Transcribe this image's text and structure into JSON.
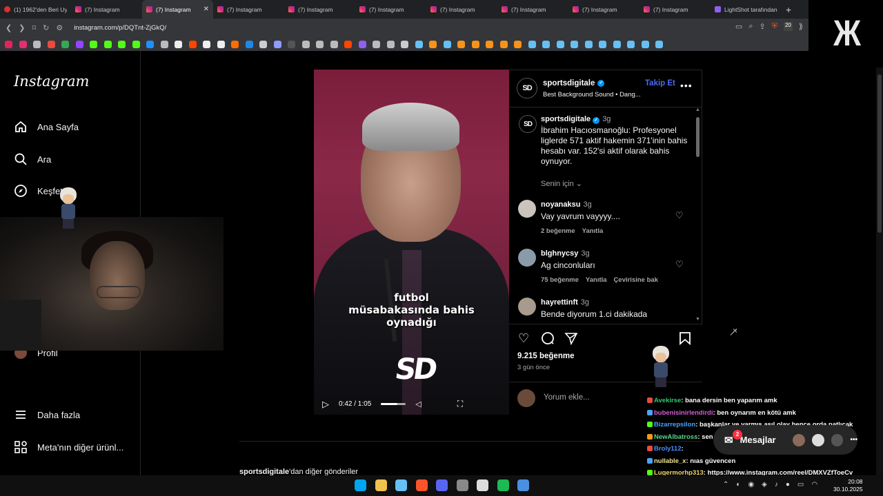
{
  "browser": {
    "tabs": [
      {
        "label": "(1) 1962'den Beri Uy",
        "icon": "red-circle",
        "active": false
      },
      {
        "label": "(7) Instagram",
        "icon": "instagram",
        "active": false
      },
      {
        "label": "(7) Instagram",
        "icon": "instagram",
        "active": true
      },
      {
        "label": "(7) Instagram",
        "icon": "instagram",
        "active": false
      },
      {
        "label": "(7) Instagram",
        "icon": "instagram",
        "active": false
      },
      {
        "label": "(7) Instagram",
        "icon": "instagram",
        "active": false
      },
      {
        "label": "(7) Instagram",
        "icon": "instagram",
        "active": false
      },
      {
        "label": "(7) Instagram",
        "icon": "instagram",
        "active": false
      },
      {
        "label": "(7) Instagram",
        "icon": "instagram",
        "active": false
      },
      {
        "label": "(7) Instagram",
        "icon": "instagram",
        "active": false
      },
      {
        "label": "LightShot tarafından",
        "icon": "lightshot",
        "active": false
      }
    ],
    "close_glyph": "✕",
    "newtab_glyph": "+",
    "url": "instagram.com/p/DQTnt-ZjGkQ/",
    "shield_count": "20",
    "bookmark_colors": [
      "#e0245e",
      "#e1306c",
      "#bbbbbb",
      "#e74c3c",
      "#34a853",
      "#9146ff",
      "#53fc18",
      "#53fc18",
      "#53fc18",
      "#53fc18",
      "#1e90ff",
      "#bbbbbb",
      "#eeeeee",
      "#ff4500",
      "#eeeeee",
      "#eeeeee",
      "#ff6d00",
      "#1e88e5",
      "#cccccc",
      "#8e9bff",
      "#555555",
      "#bbbbbb",
      "#bbbbbb",
      "#bbbbbb",
      "#ff4500",
      "#8e5ff0",
      "#bbbbbb",
      "#bbbbbb",
      "#cccccc",
      "#66c0f4",
      "#f7931a",
      "#66c0f4",
      "#f7931a",
      "#f7931a",
      "#f7931a",
      "#f7931a",
      "#f7931a",
      "#66c0f4",
      "#66c0f4",
      "#66c0f4",
      "#66c0f4",
      "#66c0f4",
      "#66c0f4",
      "#66c0f4",
      "#66c0f4",
      "#66c0f4",
      "#66c0f4"
    ]
  },
  "brand_logo": "Ж",
  "sidebar": {
    "logo": "Instagram",
    "items": [
      {
        "label": "Ana Sayfa",
        "icon": "home-icon"
      },
      {
        "label": "Ara",
        "icon": "search-icon"
      },
      {
        "label": "Keşfet",
        "icon": "compass-icon"
      },
      {
        "label": "Profil",
        "icon": "avatar"
      },
      {
        "label": "Daha fazla",
        "icon": "menu-icon"
      },
      {
        "label": "Meta'nın diğer ürünl...",
        "icon": "grid-icon"
      }
    ]
  },
  "video": {
    "caption_lines": [
      "futbol",
      "müsabakasında bahis",
      "oynadığı"
    ],
    "watermark": "SD",
    "time": "0:42 / 1:05",
    "progress": 0.646
  },
  "post": {
    "author": "sportsdigitale",
    "audio": "Best Background Sound • Dang...",
    "follow": "Takip Et",
    "more": "•••",
    "caption_author": "sportsdigitale",
    "caption_age": "3g",
    "caption": "İbrahim Hacıosmanoğlu: Profesyonel liglerde 571 aktif hakemin 371'inin bahis hesabı var. 152'si aktif olarak bahis oynuyor.",
    "for_you": "Senin için",
    "comments": [
      {
        "user": "noyanaksu",
        "age": "3g",
        "text": "Vay yavrum vayyyy....",
        "likes": "2 beğenme",
        "reply": "Yanıtla",
        "translate": ""
      },
      {
        "user": "blghnycsy",
        "age": "3g",
        "text": "Ag cinconluları",
        "likes": "75 beğenme",
        "reply": "Yanıtla",
        "translate": "Çevirisine bak"
      },
      {
        "user": "hayrettinft",
        "age": "3g",
        "text": "Bende diyorum 1.ci dakikada",
        "likes": "",
        "reply": "",
        "translate": ""
      }
    ],
    "likes": "9.215 beğenme",
    "posted": "3 gün önce",
    "comment_placeholder": "Yorum ekle..."
  },
  "more_posts": {
    "user": "sportsdigitale",
    "suffix": "'dan diğer gönderiler"
  },
  "chat": [
    {
      "user": "Avekirse",
      "color": "#2ecc71",
      "text": ": bana dersin ben yaparım amk"
    },
    {
      "user": "bubenisinirlendirdi",
      "color": "#d65cd6",
      "text": ": ben oynarım en kötü amk"
    },
    {
      "user": "Bizarrepsilon",
      "color": "#4aa3ff",
      "text": ": başkanlar ve varmış asıl olay bence orda patlıcak"
    },
    {
      "user": "NewAlbatross",
      "color": "#58d68d",
      "text": ": sen bana yapsını geri at"
    },
    {
      "user": "Broly112",
      "color": "#4a90ff",
      "text": ":"
    },
    {
      "user": "nullable_x",
      "color": "#f0e68c",
      "text": ": nıas güvencen"
    },
    {
      "user": "Lugermorhp313",
      "color": "#f5d76e",
      "text": ": https://www.instagram.com/reel/DMXVZfToeCv"
    }
  ],
  "messages": {
    "label": "Mesajlar",
    "count": "2"
  },
  "taskbar": {
    "icons": [
      "#00a4ef",
      "#f2c14e",
      "#66c0f4",
      "#fb542b",
      "#5865f2",
      "#888888",
      "#dddddd",
      "#1db954",
      "#4a90e2"
    ],
    "time": "20:08",
    "date": "30.10.2025"
  }
}
